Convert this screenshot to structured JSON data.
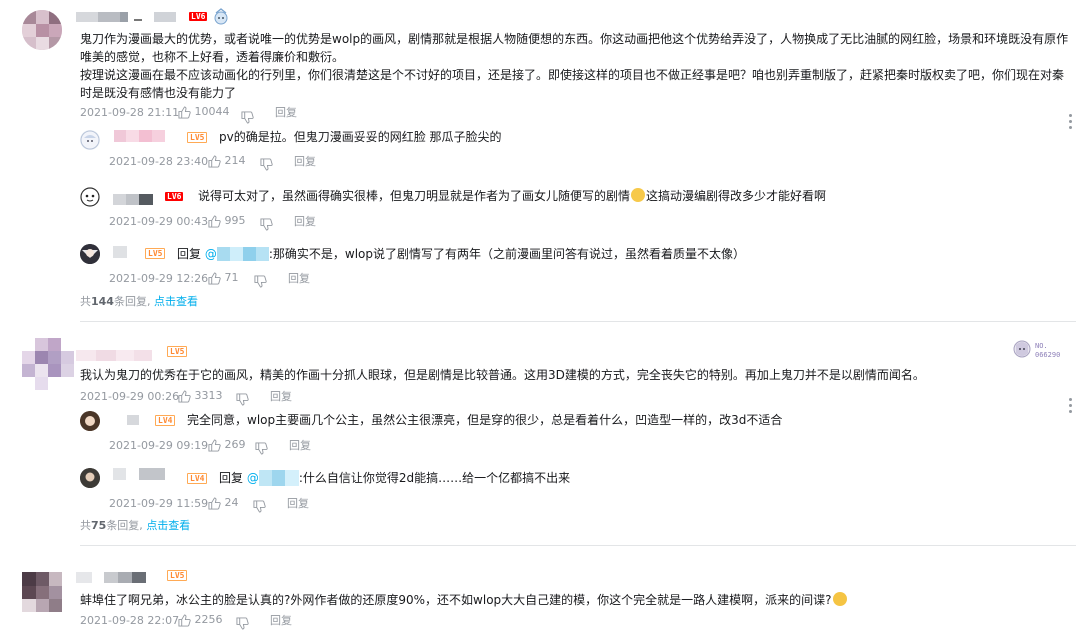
{
  "comments": [
    {
      "username": "",
      "level": "LV6",
      "text1": "鬼刀作为漫画最大的优势，或者说唯一的优势是wolp的画风，剧情那就是根据人物随便想的东西。你这动画把他这个优势给弄没了，人物换成了无比油腻的网红脸，场景和环境既没有原作",
      "text2": "唯美的感觉，也称不上好看，透着得廉价和敷衍。",
      "text3": "按理说这漫画在最不应该动画化的行列里，你们很清楚这是个不讨好的项目，还是接了。即使接这样的项目也不做正经事是吧？咱也别弄重制版了，赶紧把秦时版权卖了吧，你们现在对秦",
      "text4": "时是既没有感情也没有能力了",
      "time": "2021-09-28 21:11",
      "likes": "10044",
      "reply_label": "回复",
      "replies": [
        {
          "level": "LV5",
          "text": "pv的确是拉。但鬼刀漫画妥妥的网红脸 那瓜子脸尖的",
          "time": "2021-09-28 23:40",
          "likes": "214",
          "reply_label": "回复"
        },
        {
          "level": "LV6",
          "text": "说得可太对了，虽然画得确实很棒，但鬼刀明显就是作者为了画女儿随便写的剧情",
          "text_after": "这搞动漫编剧得改多少才能好看啊",
          "time": "2021-09-29 00:43",
          "likes": "995",
          "reply_label": "回复"
        },
        {
          "level": "LV5",
          "prefix": "回复",
          "mention": "@",
          "text": ":那确实不是，wlop说了剧情写了有两年（之前漫画里问答有说过，虽然看着质量不太像）",
          "time": "2021-09-29 12:26",
          "likes": "71",
          "reply_label": "回复"
        }
      ],
      "total_prefix": "共",
      "total_count": "144",
      "total_suffix": "条回复,",
      "view_more": "点击查看"
    },
    {
      "level": "LV5",
      "badge_no": "NO.",
      "badge_num": "066290",
      "text": "我认为鬼刀的优秀在于它的画风，精美的作画十分抓人眼球，但是剧情是比较普通。这用3D建模的方式，完全丧失它的特别。再加上鬼刀并不是以剧情而闻名。",
      "time": "2021-09-29 00:26",
      "likes": "3313",
      "reply_label": "回复",
      "replies": [
        {
          "level": "LV4",
          "text": "完全同意，wlop主要画几个公主，虽然公主很漂亮，但是穿的很少，总是看着什么，凹造型一样的，改3d不适合",
          "time": "2021-09-29 09:19",
          "likes": "269",
          "reply_label": "回复"
        },
        {
          "level": "LV4",
          "prefix": "回复",
          "mention": "@",
          "text": ":什么自信让你觉得2d能搞……给一个亿都搞不出来",
          "time": "2021-09-29 11:59",
          "likes": "24",
          "reply_label": "回复"
        }
      ],
      "total_prefix": "共",
      "total_count": "75",
      "total_suffix": "条回复,",
      "view_more": "点击查看"
    },
    {
      "level": "LV5",
      "text": "蚌埠住了啊兄弟，冰公主的脸是认真的?外网作者做的还原度90%，还不如wlop大大自己建的模，你这个完全就是一路人建模啊，派来的间谍?",
      "time": "2021-09-28 22:07",
      "likes": "2256",
      "reply_label": "回复"
    }
  ],
  "colors": {
    "link": "#00aeec",
    "meta": "#9499a0",
    "divider": "#e3e5e7",
    "text": "#18191c"
  }
}
